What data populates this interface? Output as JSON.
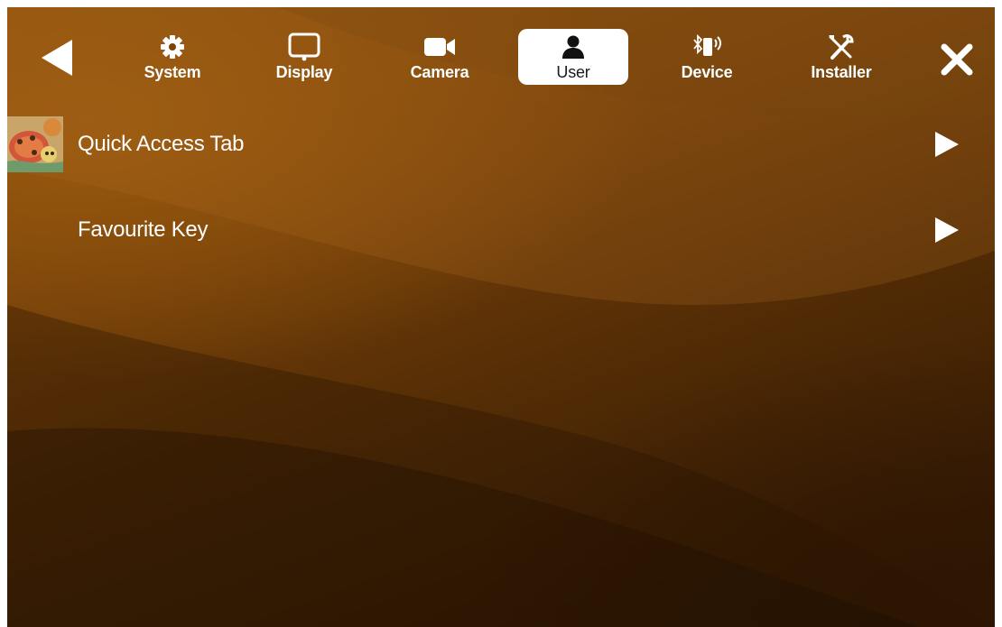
{
  "nav": {
    "back_icon": "triangle-left-icon",
    "close_icon": "close-icon",
    "tabs": [
      {
        "label": "System",
        "icon": "gear-icon"
      },
      {
        "label": "Display",
        "icon": "monitor-icon"
      },
      {
        "label": "Camera",
        "icon": "video-camera-icon"
      },
      {
        "label": "User",
        "icon": "user-icon",
        "active": true
      },
      {
        "label": "Device",
        "icon": "bluetooth-device-icon"
      },
      {
        "label": "Installer",
        "icon": "tools-icon"
      }
    ]
  },
  "menu": {
    "items": [
      {
        "label": "Quick Access Tab",
        "icon": "chevron-right-icon"
      },
      {
        "label": "Favourite Key",
        "icon": "chevron-right-icon"
      }
    ]
  },
  "colors": {
    "accent": "#ffffff",
    "background_dark": "#2f1703",
    "background_light": "#9a5a0f"
  }
}
